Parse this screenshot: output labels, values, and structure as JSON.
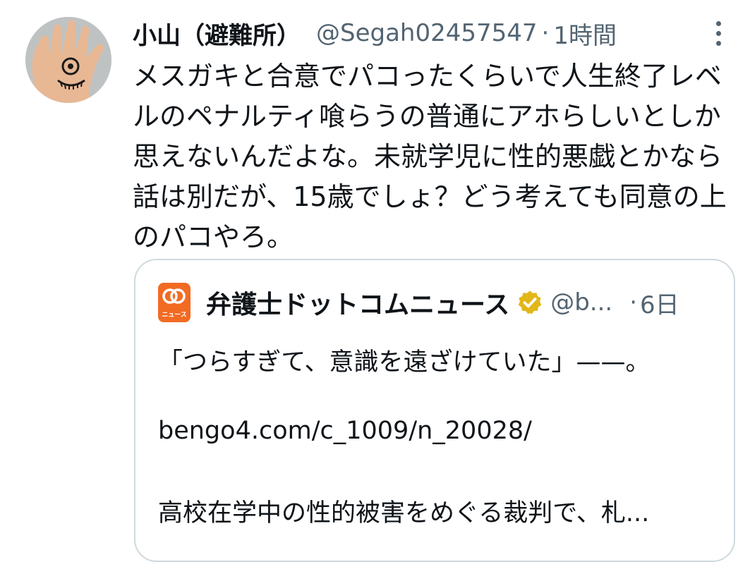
{
  "tweet": {
    "display_name": "小山（避難所）",
    "handle": "@Segah02457547",
    "separator": "·",
    "time": "1時間",
    "text_lines": [
      "メスガキと合意でパコったくらいで人生終了レベ",
      "ルのペナルティ喰らうの普通にアホらしいとしか",
      "思えないんだよな。未就学児に性的悪戯とかなら",
      "話は別だが、15歳でしょ？どう考えても同意の上",
      "のパコやろ。"
    ]
  },
  "quote": {
    "logo_text": "ニュース",
    "name": "弁護士ドットコムニュース",
    "handle": "@b...",
    "separator": "·",
    "time": "6日",
    "line1": "「つらすぎて、意識を遠ざけていた」——。",
    "link": "bengo4.com/c_1009/n_20028/",
    "line3": "高校在学中の性的被害をめぐる裁判で、札..."
  },
  "icons": {
    "more": "more-vertical-icon",
    "verified": "verified-badge-icon",
    "logo": "bengo4-logo"
  },
  "colors": {
    "text": "#0f1419",
    "secondary": "#536471",
    "border": "#cfd9de",
    "logo_orange": "#f26b23",
    "verified_gold": "#e2b719"
  }
}
